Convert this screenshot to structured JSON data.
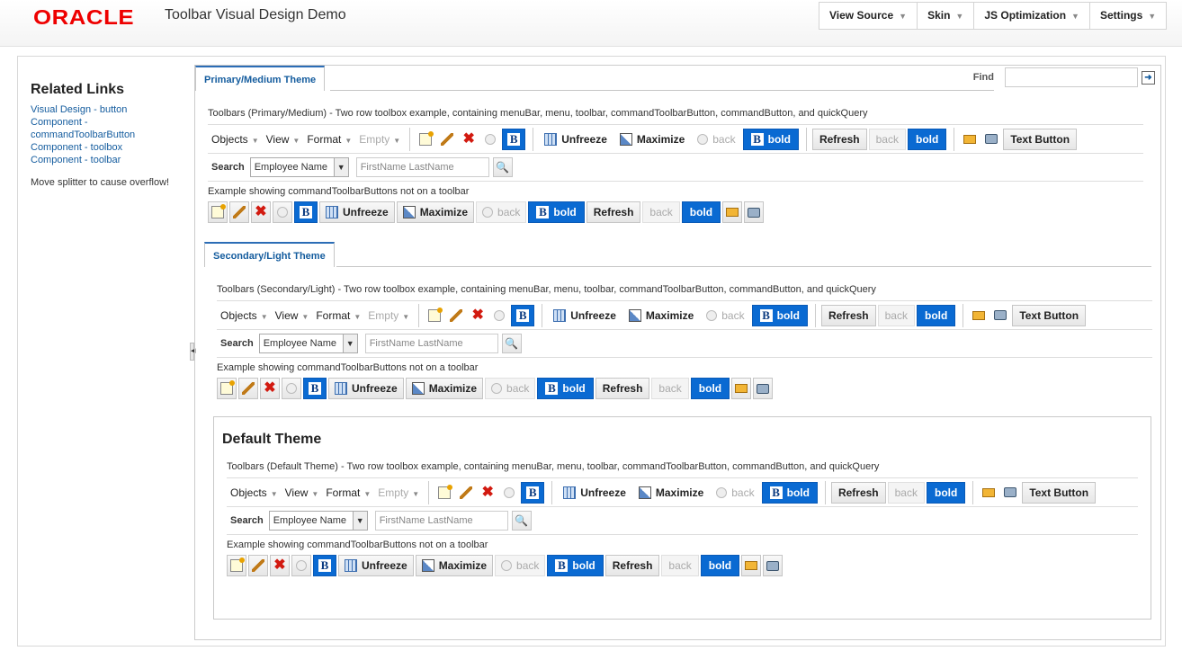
{
  "header": {
    "logo": "ORACLE",
    "title": "Toolbar Visual Design Demo",
    "menu": [
      {
        "label": "View Source"
      },
      {
        "label": "Skin"
      },
      {
        "label": "JS Optimization"
      },
      {
        "label": "Settings"
      }
    ]
  },
  "sidebar": {
    "title": "Related Links",
    "links": [
      {
        "label": "Visual Design - button"
      },
      {
        "label": "Component - commandToolbarButton"
      },
      {
        "label": "Component - toolbox"
      },
      {
        "label": "Component - toolbar"
      }
    ],
    "note": "Move splitter to cause overflow!"
  },
  "find": {
    "label": "Find"
  },
  "toolbar": {
    "menus": [
      "Objects",
      "View",
      "Format",
      "Empty"
    ],
    "unfreeze": "Unfreeze",
    "maximize": "Maximize",
    "back": "back",
    "bold": "bold",
    "refresh": "Refresh",
    "text_button": "Text Button",
    "search_label": "Search",
    "search_select": "Employee Name",
    "query_placeholder": "FirstName LastName"
  },
  "sections": {
    "primary": {
      "tab": "Primary/Medium Theme",
      "desc": "Toolbars (Primary/Medium) - Two row toolbox example, containing menuBar, menu, toolbar, commandToolbarButton, commandButton, and quickQuery",
      "example": "Example showing commandToolbarButtons not on a toolbar"
    },
    "secondary": {
      "tab": "Secondary/Light Theme",
      "desc": "Toolbars (Secondary/Light) - Two row toolbox example, containing menuBar, menu, toolbar, commandToolbarButton, commandButton, and quickQuery",
      "example": "Example showing commandToolbarButtons not on a toolbar"
    },
    "default": {
      "title": "Default Theme",
      "desc": "Toolbars (Default Theme) - Two row toolbox example, containing menuBar, menu, toolbar, commandToolbarButton, commandButton, and quickQuery",
      "example": "Example showing commandToolbarButtons not on a toolbar"
    }
  },
  "colors": {
    "oracle_red": "#e00000",
    "accent_blue": "#0a6ad2",
    "link": "#145c9e"
  }
}
